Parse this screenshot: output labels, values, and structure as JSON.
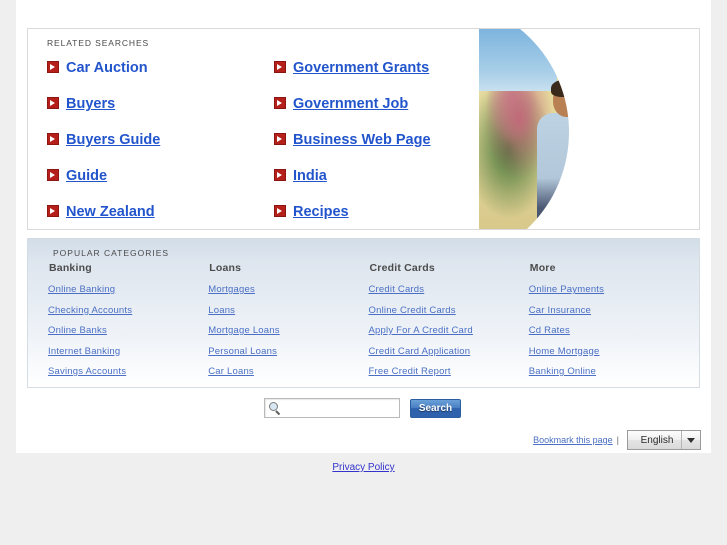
{
  "theme": {
    "top_bar_color": "#4083c8",
    "link_color": "#2255cc",
    "bullet_color": "#b41f19",
    "panel_bg": "#ffffff",
    "page_bg": "#efefef",
    "category_link_color": "#4a6fc4"
  },
  "related": {
    "section_label": "RELATED SEARCHES",
    "left_items": [
      {
        "label": "Car Auction"
      },
      {
        "label": "Buyers"
      },
      {
        "label": "Buyers Guide"
      },
      {
        "label": "Guide"
      },
      {
        "label": "New Zealand"
      }
    ],
    "right_items": [
      {
        "label": "Government Grants"
      },
      {
        "label": "Government Job"
      },
      {
        "label": "Business Web Page"
      },
      {
        "label": "India"
      },
      {
        "label": "Recipes"
      }
    ]
  },
  "popular": {
    "section_label": "POPULAR CATEGORIES",
    "columns": [
      {
        "heading": "Banking",
        "links": [
          "Online Banking",
          "Checking Accounts",
          "Online Banks",
          "Internet Banking",
          "Savings Accounts"
        ]
      },
      {
        "heading": "Loans",
        "links": [
          "Mortgages",
          "Loans",
          "Mortgage Loans",
          "Personal Loans",
          "Car Loans"
        ]
      },
      {
        "heading": "Credit Cards",
        "links": [
          "Credit Cards",
          "Online Credit Cards",
          "Apply For A Credit Card",
          "Credit Card Application",
          "Free Credit Report"
        ]
      },
      {
        "heading": "More",
        "links": [
          "Online Payments",
          "Car Insurance",
          "Cd Rates",
          "Home Mortgage",
          "Banking Online"
        ]
      }
    ]
  },
  "search": {
    "value": "",
    "placeholder": "",
    "button_label": "Search",
    "icon": "magnifier-icon"
  },
  "bottom": {
    "bookmark_label": "Bookmark this page",
    "separator": "|",
    "language_selected": "English",
    "language_options": [
      "English"
    ]
  },
  "footer": {
    "privacy_label": "Privacy Policy"
  },
  "hero": {
    "alt": "family-in-front-of-house-photo"
  }
}
